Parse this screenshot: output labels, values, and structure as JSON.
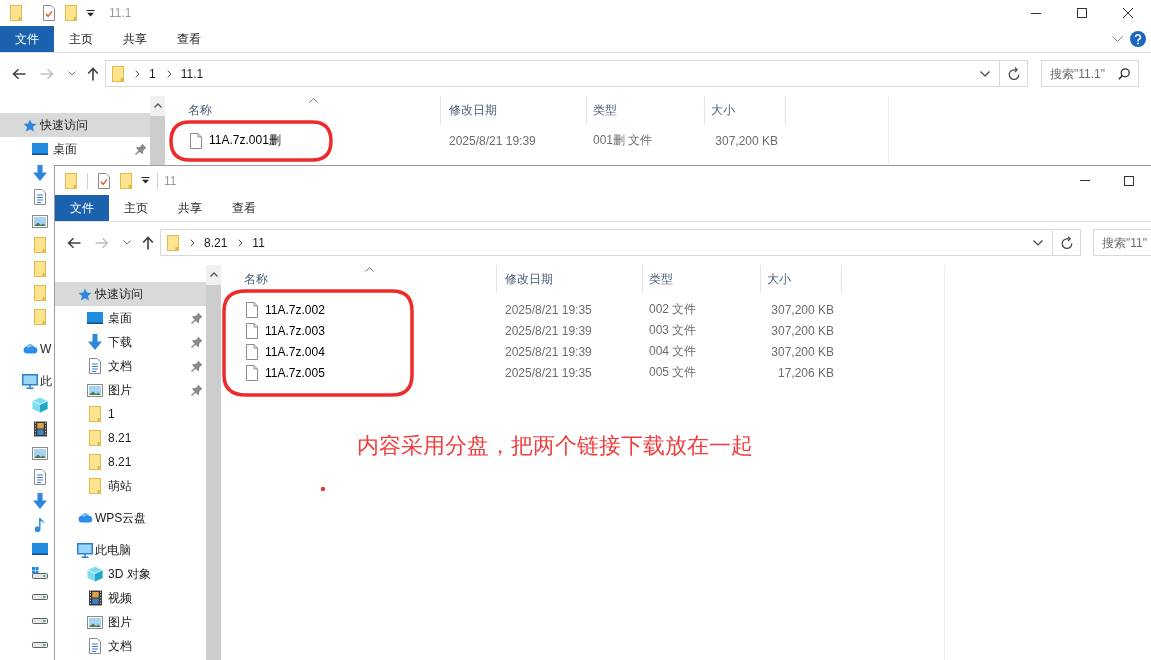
{
  "windows": [
    {
      "title": "11.1",
      "window_buttons": [
        {
          "kind": "minimize"
        },
        {
          "kind": "maximize"
        },
        {
          "kind": "close"
        }
      ],
      "ribbon_tabs": [
        {
          "label": "文件",
          "selected": true
        },
        {
          "label": "主页",
          "selected": false
        },
        {
          "label": "共享",
          "selected": false
        },
        {
          "label": "查看",
          "selected": false
        }
      ],
      "ribbon_buttons": [
        {
          "kind": "expand"
        },
        {
          "kind": "help"
        }
      ],
      "nav_buttons": [
        {
          "kind": "back",
          "disabled": false
        },
        {
          "kind": "forward",
          "disabled": true
        },
        {
          "kind": "recent",
          "disabled": false
        },
        {
          "kind": "up",
          "disabled": false
        }
      ],
      "address": [
        "1",
        "11.1"
      ],
      "search": {
        "placeholder": "搜索\"11.1\"",
        "buttons": [
          {
            "kind": "search"
          }
        ]
      },
      "nav": [
        {
          "kind": "star",
          "label": "快速访问",
          "selected": true,
          "pinned": false,
          "children": [
            {
              "kind": "desktop",
              "label": "桌面",
              "selected": false,
              "pinned": true
            },
            {
              "kind": "download",
              "selected": false,
              "pinned": false
            },
            {
              "kind": "documents",
              "selected": false,
              "pinned": false
            },
            {
              "kind": "pictures",
              "selected": false,
              "pinned": false
            },
            {
              "kind": "folder",
              "selected": false,
              "pinned": false
            },
            {
              "kind": "folder",
              "selected": false,
              "pinned": false
            },
            {
              "kind": "folder",
              "selected": false,
              "pinned": false
            },
            {
              "kind": "folder",
              "selected": false,
              "pinned": false
            }
          ]
        },
        {
          "kind": "cloud",
          "label": "W",
          "selected": false,
          "pinned": false
        },
        {
          "kind": "computer",
          "label": "此",
          "selected": false,
          "pinned": false,
          "children": [
            {
              "kind": "cube",
              "selected": false,
              "pinned": false
            },
            {
              "kind": "video",
              "selected": false,
              "pinned": false
            },
            {
              "kind": "pictures",
              "selected": false,
              "pinned": false
            },
            {
              "kind": "documents",
              "selected": false,
              "pinned": false
            },
            {
              "kind": "download",
              "selected": false,
              "pinned": false
            },
            {
              "kind": "music",
              "selected": false,
              "pinned": false
            },
            {
              "kind": "desktop",
              "selected": false,
              "pinned": false
            },
            {
              "kind": "system-drive",
              "selected": false,
              "pinned": false
            },
            {
              "kind": "drive",
              "selected": false,
              "pinned": false
            },
            {
              "kind": "drive",
              "selected": false,
              "pinned": false
            },
            {
              "kind": "drive",
              "selected": false,
              "pinned": false
            }
          ]
        }
      ],
      "columns": [
        {
          "label": "名称",
          "sorted": true
        },
        {
          "label": "修改日期",
          "sorted": false
        },
        {
          "label": "类型",
          "sorted": false
        },
        {
          "label": "大小",
          "sorted": false
        }
      ],
      "files": [
        {
          "name": "11A.7z.001删",
          "modified": "2025/8/21 19:39",
          "type": "001删 文件",
          "size": "307,200 KB"
        }
      ]
    },
    {
      "title": "11",
      "window_buttons": [
        {
          "kind": "minimize"
        },
        {
          "kind": "maximize"
        }
      ],
      "ribbon_tabs": [
        {
          "label": "文件",
          "selected": true
        },
        {
          "label": "主页",
          "selected": false
        },
        {
          "label": "共享",
          "selected": false
        },
        {
          "label": "查看",
          "selected": false
        }
      ],
      "nav_buttons": [
        {
          "kind": "back",
          "disabled": false
        },
        {
          "kind": "forward",
          "disabled": true
        },
        {
          "kind": "recent",
          "disabled": false
        },
        {
          "kind": "up",
          "disabled": false
        }
      ],
      "address": [
        "8.21",
        "11"
      ],
      "search": {
        "placeholder": "搜索\"11\""
      },
      "nav": [
        {
          "kind": "star",
          "label": "快速访问",
          "selected": true,
          "pinned": false,
          "children": [
            {
              "kind": "desktop",
              "label": "桌面",
              "selected": false,
              "pinned": true
            },
            {
              "kind": "download",
              "label": "下载",
              "selected": false,
              "pinned": true
            },
            {
              "kind": "documents",
              "label": "文档",
              "selected": false,
              "pinned": true
            },
            {
              "kind": "pictures",
              "label": "图片",
              "selected": false,
              "pinned": true
            },
            {
              "kind": "folder",
              "label": "1",
              "selected": false,
              "pinned": false
            },
            {
              "kind": "folder",
              "label": "8.21",
              "selected": false,
              "pinned": false
            },
            {
              "kind": "folder",
              "label": "8.21",
              "selected": false,
              "pinned": false
            },
            {
              "kind": "folder",
              "label": "萌站",
              "selected": false,
              "pinned": false
            }
          ]
        },
        {
          "kind": "cloud",
          "label": "WPS云盘",
          "selected": false,
          "pinned": false
        },
        {
          "kind": "computer",
          "label": "此电脑",
          "selected": false,
          "pinned": false,
          "children": [
            {
              "kind": "cube",
              "label": "3D 对象",
              "selected": false,
              "pinned": false
            },
            {
              "kind": "video",
              "label": "视频",
              "selected": false,
              "pinned": false
            },
            {
              "kind": "pictures",
              "label": "图片",
              "selected": false,
              "pinned": false
            },
            {
              "kind": "documents",
              "label": "文档",
              "selected": false,
              "pinned": false
            }
          ]
        }
      ],
      "columns": [
        {
          "label": "名称",
          "sorted": true
        },
        {
          "label": "修改日期",
          "sorted": false
        },
        {
          "label": "类型",
          "sorted": false
        },
        {
          "label": "大小",
          "sorted": false
        }
      ],
      "files": [
        {
          "name": "11A.7z.002",
          "modified": "2025/8/21 19:35",
          "type": "002 文件",
          "size": "307,200 KB"
        },
        {
          "name": "11A.7z.003",
          "modified": "2025/8/21 19:39",
          "type": "003 文件",
          "size": "307,200 KB"
        },
        {
          "name": "11A.7z.004",
          "modified": "2025/8/21 19:39",
          "type": "004 文件",
          "size": "307,200 KB"
        },
        {
          "name": "11A.7z.005",
          "modified": "2025/8/21 19:35",
          "type": "005 文件",
          "size": "17,206 KB"
        }
      ]
    }
  ],
  "annotation": {
    "text": "内容采用分盘，把两个链接下载放在一起"
  }
}
